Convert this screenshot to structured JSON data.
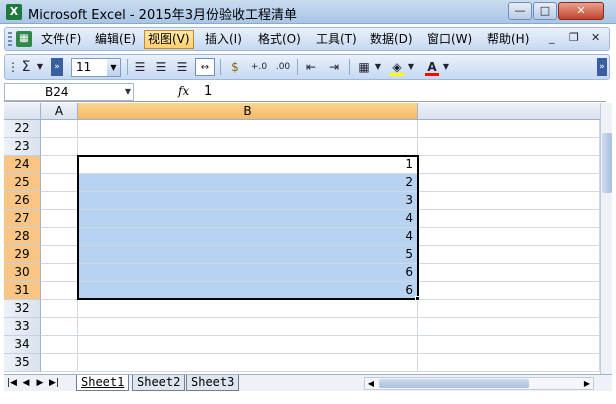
{
  "window": {
    "title": "Microsoft Excel - 2015年3月份验收工程清单",
    "app_icon": "excel-icon",
    "controls": {
      "minimize": "—",
      "maximize": "□",
      "close": "✕"
    }
  },
  "menubar": {
    "items": [
      {
        "label": "文件(F)"
      },
      {
        "label": "编辑(E)"
      },
      {
        "label": "视图(V)"
      },
      {
        "label": "插入(I)"
      },
      {
        "label": "格式(O)"
      },
      {
        "label": "工具(T)"
      },
      {
        "label": "数据(D)"
      },
      {
        "label": "窗口(W)"
      },
      {
        "label": "帮助(H)"
      }
    ],
    "active_item": "视图(V)",
    "doc_controls": {
      "minimize": "_",
      "restore": "❐",
      "close": "✕"
    }
  },
  "toolbar": {
    "autosum": "Σ",
    "font_size": "11",
    "buttons": [
      "align-left-icon",
      "align-center-icon",
      "align-right-icon",
      "merge-center-icon",
      "currency-icon",
      "increase-decimal-icon",
      "decrease-decimal-icon",
      "decrease-indent-icon",
      "increase-indent-icon",
      "borders-icon",
      "fill-color-icon",
      "font-color-icon"
    ],
    "fill_color": "#ffff00",
    "font_color": "#ff0000"
  },
  "formulabar": {
    "name_box": "B24",
    "fx": "fx",
    "formula": "1"
  },
  "grid": {
    "columns": [
      "A",
      "B"
    ],
    "selected_column": "B",
    "rows": [
      {
        "row": "22",
        "b": ""
      },
      {
        "row": "23",
        "b": ""
      },
      {
        "row": "24",
        "b": "1"
      },
      {
        "row": "25",
        "b": "2"
      },
      {
        "row": "26",
        "b": "3"
      },
      {
        "row": "27",
        "b": "4"
      },
      {
        "row": "28",
        "b": "4"
      },
      {
        "row": "29",
        "b": "5"
      },
      {
        "row": "30",
        "b": "6"
      },
      {
        "row": "31",
        "b": "6"
      },
      {
        "row": "32",
        "b": ""
      },
      {
        "row": "33",
        "b": ""
      },
      {
        "row": "34",
        "b": ""
      },
      {
        "row": "35",
        "b": ""
      }
    ],
    "selected_rows": [
      "24",
      "25",
      "26",
      "27",
      "28",
      "29",
      "30",
      "31"
    ],
    "selection_color": "#b8d3f2",
    "header_highlight_color": "#f4b96a"
  },
  "sheets": {
    "tabs": [
      "Sheet1",
      "Sheet2",
      "Sheet3"
    ],
    "active": "Sheet1"
  }
}
